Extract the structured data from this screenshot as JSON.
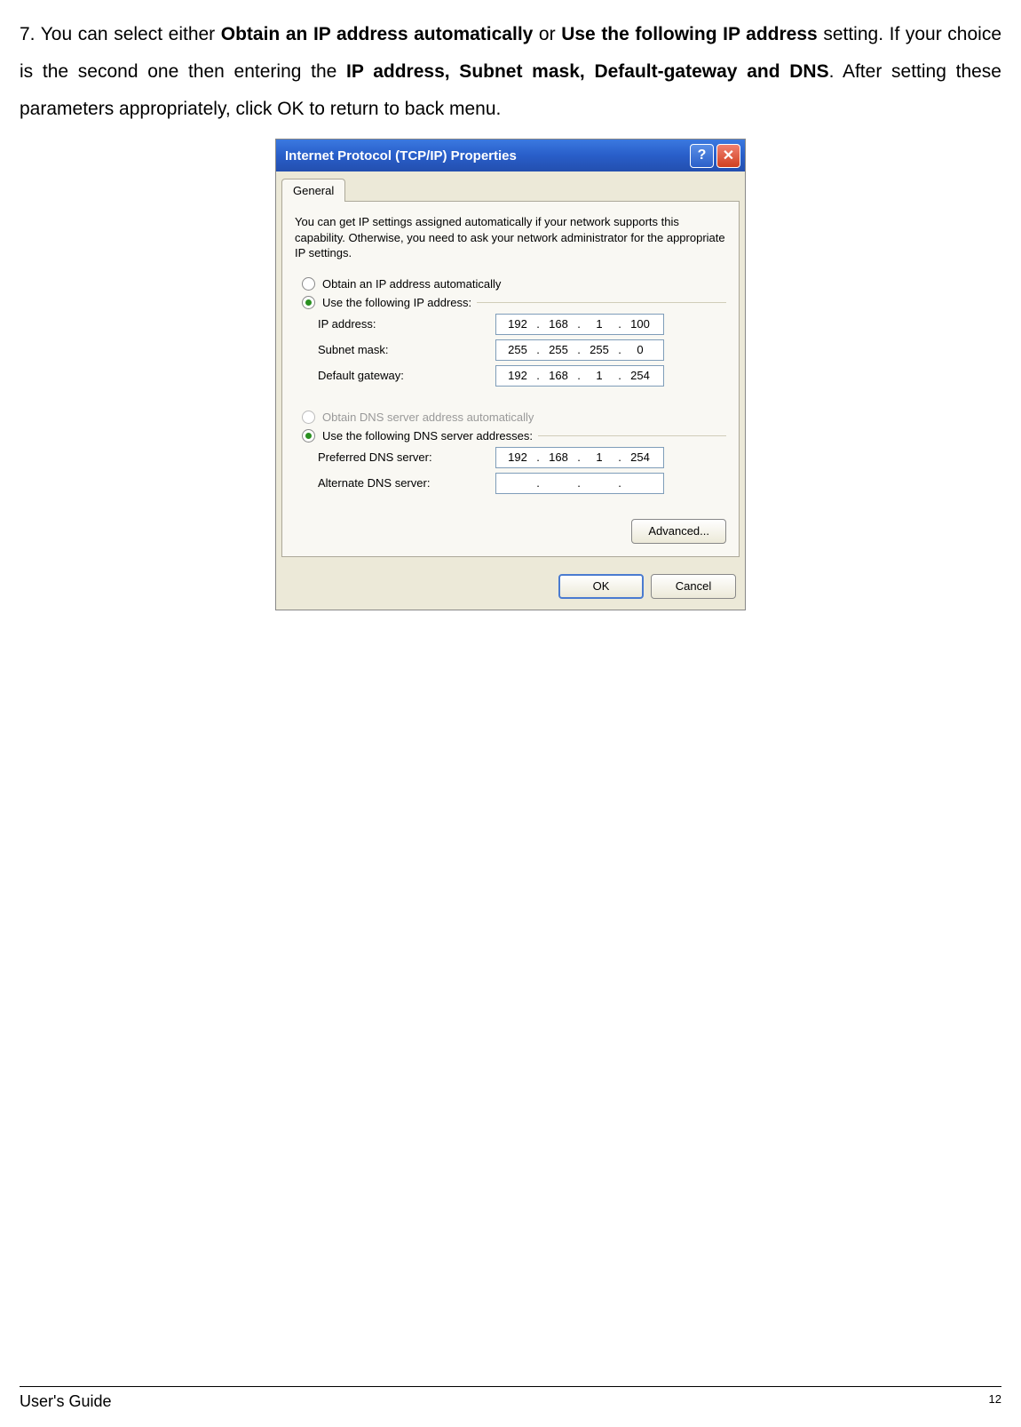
{
  "body_text": {
    "prefix": "7. You can select either ",
    "bold1": "Obtain an IP address automatically",
    "mid1": " or ",
    "bold2": "Use the following IP address",
    "mid2": " setting. If your choice is the second one then entering the ",
    "bold3": "IP address, Subnet mask, Default-gateway and DNS",
    "suffix": ". After setting these parameters appropriately, click OK to return to back menu."
  },
  "dialog": {
    "title": "Internet Protocol (TCP/IP) Properties",
    "help_glyph": "?",
    "close_glyph": "✕",
    "tab": "General",
    "intro": "You can get IP settings assigned automatically if your network supports this capability. Otherwise, you need to ask your network administrator for the appropriate IP settings.",
    "radio_obtain_ip": "Obtain an IP address automatically",
    "radio_use_ip": "Use the following IP address:",
    "ip_label": "IP address:",
    "ip_value": {
      "a": "192",
      "b": "168",
      "c": "1",
      "d": "100"
    },
    "subnet_label": "Subnet mask:",
    "subnet_value": {
      "a": "255",
      "b": "255",
      "c": "255",
      "d": "0"
    },
    "gateway_label": "Default gateway:",
    "gateway_value": {
      "a": "192",
      "b": "168",
      "c": "1",
      "d": "254"
    },
    "radio_obtain_dns": "Obtain DNS server address automatically",
    "radio_use_dns": "Use the following DNS server addresses:",
    "pref_dns_label": "Preferred DNS server:",
    "pref_dns_value": {
      "a": "192",
      "b": "168",
      "c": "1",
      "d": "254"
    },
    "alt_dns_label": "Alternate DNS server:",
    "alt_dns_value": {
      "a": "",
      "b": "",
      "c": "",
      "d": ""
    },
    "advanced_btn": "Advanced...",
    "ok_btn": "OK",
    "cancel_btn": "Cancel"
  },
  "footer": {
    "guide": "User's Guide",
    "page": "12"
  }
}
